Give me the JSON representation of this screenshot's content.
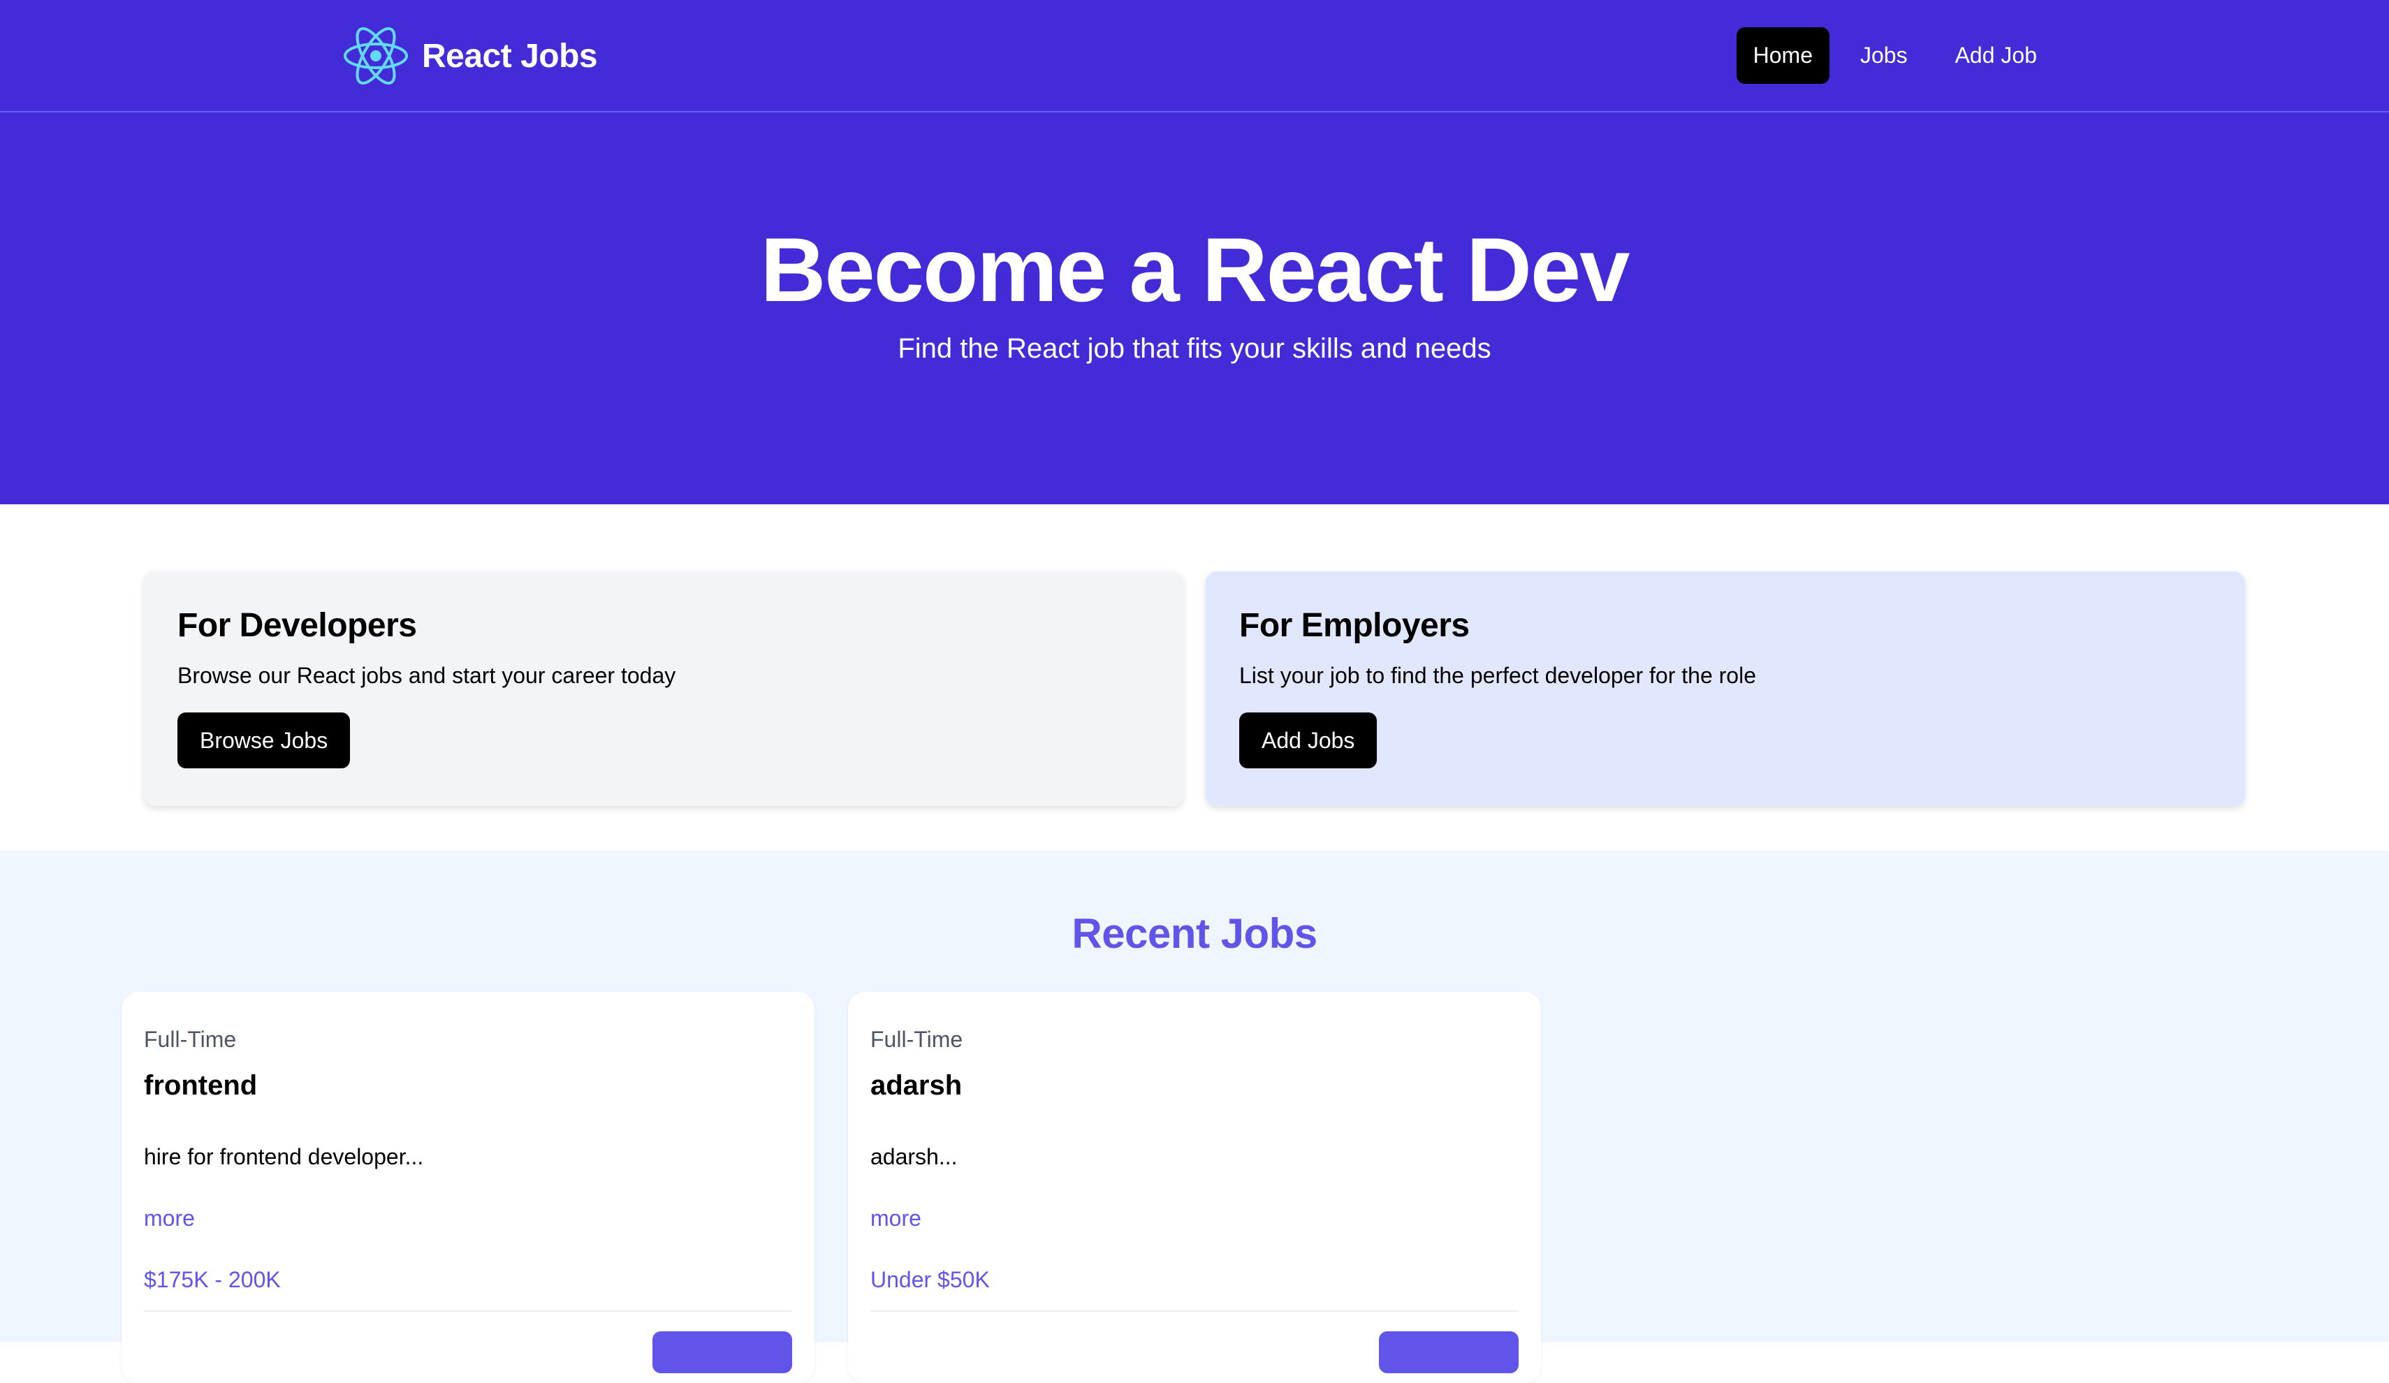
{
  "navbar": {
    "brand": "React Jobs",
    "links": [
      {
        "label": "Home",
        "active": true
      },
      {
        "label": "Jobs",
        "active": false
      },
      {
        "label": "Add Job",
        "active": false
      }
    ]
  },
  "hero": {
    "title": "Become a React Dev",
    "subtitle": "Find the React job that fits your skills and needs"
  },
  "cards": {
    "developers": {
      "title": "For Developers",
      "text": "Browse our React jobs and start your career today",
      "button": "Browse Jobs"
    },
    "employers": {
      "title": "For Employers",
      "text": "List your job to find the perfect developer for the role",
      "button": "Add Jobs"
    }
  },
  "recent": {
    "title": "Recent Jobs",
    "jobs": [
      {
        "type": "Full-Time",
        "title": "frontend",
        "description": "hire for frontend developer...",
        "more": "more",
        "salary": "$175K - 200K"
      },
      {
        "type": "Full-Time",
        "title": "adarsh",
        "description": "adarsh...",
        "more": "more",
        "salary": "Under $50K"
      }
    ]
  },
  "colors": {
    "primary": "#432cd8",
    "accent": "#6154e8",
    "react_logo": "#61dafb"
  },
  "icons": {
    "brand_logo": "react-atom-icon"
  }
}
